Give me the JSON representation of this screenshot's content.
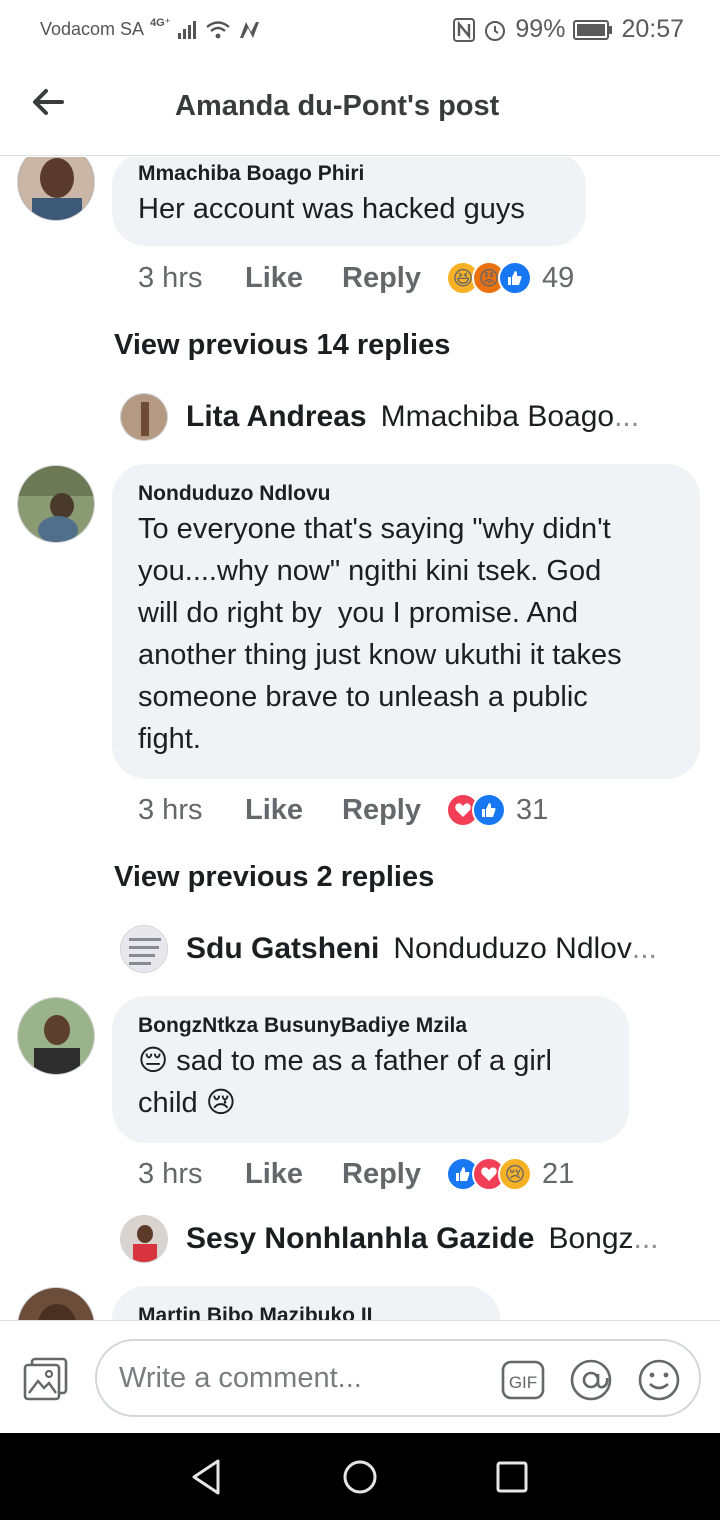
{
  "status_bar": {
    "carrier": "Vodacom SA",
    "network": "4G⁺",
    "battery": "99%",
    "time": "20:57"
  },
  "header": {
    "title": "Amanda du-Pont's post"
  },
  "comments": [
    {
      "author": "Mmachiba Boago Phiri",
      "text": "Her account was hacked guys",
      "time": "3 hrs",
      "like_label": "Like",
      "reply_label": "Reply",
      "reaction_icons": [
        "laugh-reaction-icon",
        "angry-reaction-icon",
        "like-reaction-icon"
      ],
      "reaction_count": "49",
      "view_previous": "View previous 14 replies",
      "latest_reply": {
        "author": "Lita Andreas",
        "preview": "Mmachiba Boago",
        "ellipsis": "..."
      }
    },
    {
      "author": "Nonduduzo Ndlovu",
      "text_lines": [
        "To everyone that's saying \"why didn't",
        "you....why now\" ngithi kini tsek. God",
        "will do right by  you I promise. And",
        "another thing just know ukuthi it takes",
        "someone brave to unleash a public",
        "fight."
      ],
      "time": "3 hrs",
      "like_label": "Like",
      "reply_label": "Reply",
      "reaction_icons": [
        "love-reaction-icon",
        "like-reaction-icon"
      ],
      "reaction_count": "31",
      "view_previous": "View previous 2 replies",
      "latest_reply": {
        "author": "Sdu Gatsheni",
        "preview": "Nonduduzo Ndlov",
        "ellipsis": "..."
      }
    },
    {
      "author": "BongzNtkza BusunyBadiye Mzila",
      "line1_emoji": "😔",
      "line1_text": "sad to me as a father of a girl",
      "line2_text": "child",
      "line2_emoji": "😢",
      "time": "3 hrs",
      "like_label": "Like",
      "reply_label": "Reply",
      "reaction_icons": [
        "like-reaction-icon",
        "love-reaction-icon",
        "sad-reaction-icon"
      ],
      "reaction_count": "21",
      "latest_reply": {
        "author": "Sesy Nonhlanhla Gazide",
        "preview": "Bongz",
        "ellipsis": "..."
      }
    },
    {
      "author": "Martin Bibo Mazibuko II"
    }
  ],
  "composer": {
    "placeholder": "Write a comment...",
    "gif_label": "GIF"
  },
  "colors": {
    "bubble": "#f0f2f5",
    "meta_text": "#65676b",
    "like_blue": "#1877f2",
    "love_red": "#f33e58",
    "haha_yellow": "#f7b125"
  }
}
